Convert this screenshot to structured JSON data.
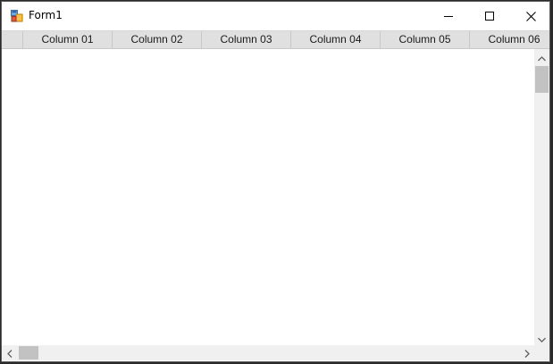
{
  "window": {
    "title": "Form1"
  },
  "grid": {
    "columns": [
      "Column 01",
      "Column 02",
      "Column 03",
      "Column 04",
      "Column 05",
      "Column 06"
    ]
  },
  "colors": {
    "header_background": "#e0e0e0",
    "scrollbar_track": "#f0f0f0",
    "scrollbar_thumb": "#c2c2c2"
  }
}
